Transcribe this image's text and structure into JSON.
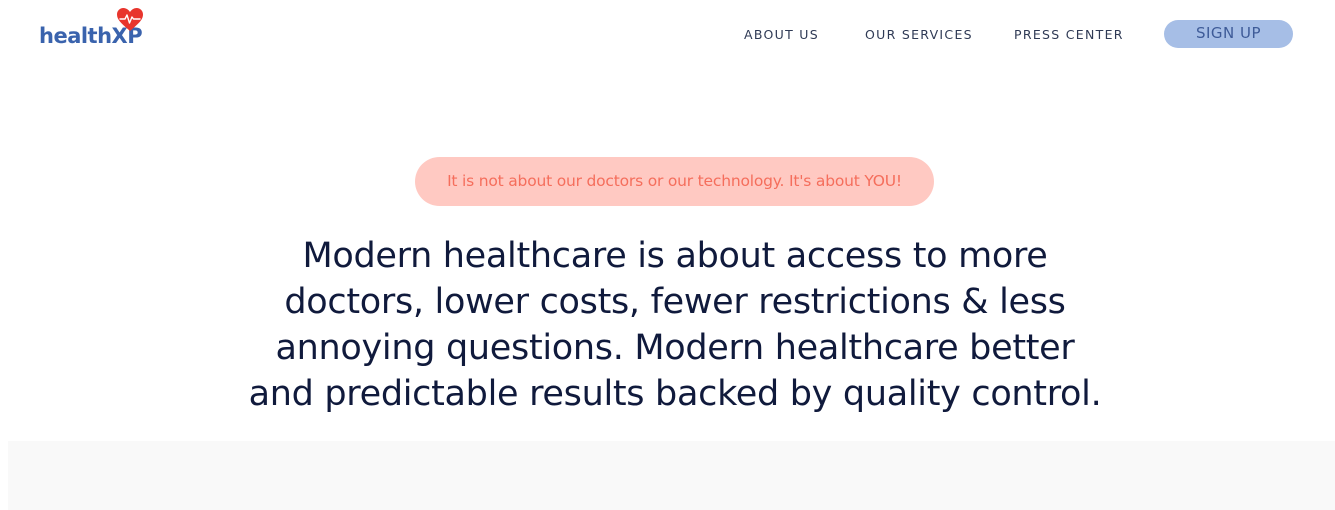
{
  "brand": {
    "name": "healthXP",
    "text_color": "#3a63ad",
    "heart_color": "#e8352d",
    "icon": "heart-pulse-icon"
  },
  "nav": {
    "items": [
      {
        "label": "ABOUT US"
      },
      {
        "label": "OUR SERVICES"
      },
      {
        "label": "PRESS CENTER"
      }
    ],
    "signup_label": "SIGN UP",
    "signup_bg": "#a6bee6"
  },
  "hero": {
    "tagline": "It is not about our doctors or our technology. It's about YOU!",
    "tagline_bg": "#ffc9c2",
    "tagline_color": "#f56e5c",
    "headline_lines": [
      "Modern healthcare is about access to more",
      "doctors, lower costs, fewer restrictions & less",
      "annoying questions. Modern healthcare better",
      "and predictable results backed by quality control."
    ],
    "headline_color": "#101a3c"
  }
}
